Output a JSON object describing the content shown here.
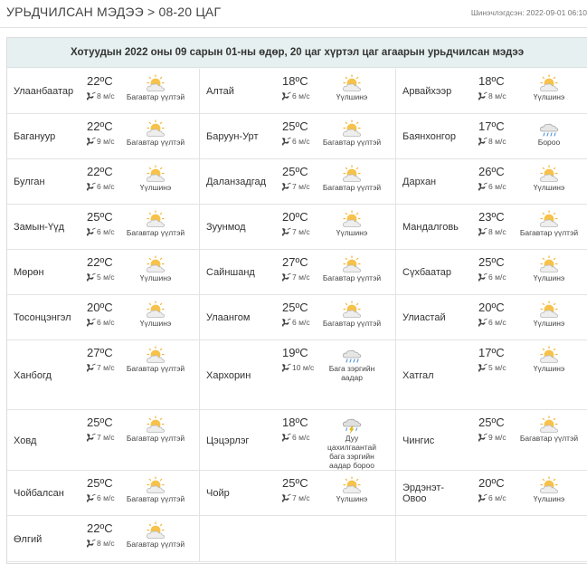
{
  "header": {
    "title": "УРЬДЧИЛСАН МЭДЭЭ > 08-20 ЦАГ",
    "updated": "Шинэчлэгдсэн: 2022-09-01 06:10"
  },
  "banner": {
    "text": "Хотуудын 2022 оны 09 сарын 01-ны өдөр, 20 цаг хүртэл цаг агаарын урьдчилсан мэдээ"
  },
  "temp_unit": "ºC",
  "wind_unit": "м/с",
  "icon_names": {
    "sun-cloud": "partly-cloudy-icon",
    "rain": "rain-icon",
    "storm": "thunderstorm-icon"
  },
  "columns": [
    [
      {
        "city": "Улаанбаатар",
        "temp": "22",
        "wind": "8",
        "condition": "Багавтар үүлтэй",
        "icon": "sun-cloud"
      },
      {
        "city": "Багануур",
        "temp": "22",
        "wind": "9",
        "condition": "Багавтар үүлтэй",
        "icon": "sun-cloud"
      },
      {
        "city": "Булган",
        "temp": "22",
        "wind": "6",
        "condition": "Үүлшинэ",
        "icon": "sun-cloud"
      },
      {
        "city": "Замын-Үүд",
        "temp": "25",
        "wind": "6",
        "condition": "Багавтар үүлтэй",
        "icon": "sun-cloud"
      },
      {
        "city": "Мөрөн",
        "temp": "22",
        "wind": "5",
        "condition": "Үүлшинэ",
        "icon": "sun-cloud"
      },
      {
        "city": "Тосонцэнгэл",
        "temp": "20",
        "wind": "6",
        "condition": "Үүлшинэ",
        "icon": "sun-cloud"
      },
      {
        "city": "Ханбогд",
        "temp": "27",
        "wind": "7",
        "condition": "Багавтар үүлтэй",
        "icon": "sun-cloud"
      },
      {
        "city": "Ховд",
        "temp": "25",
        "wind": "7",
        "condition": "Багавтар үүлтэй",
        "icon": "sun-cloud"
      },
      {
        "city": "Чойбалсан",
        "temp": "25",
        "wind": "6",
        "condition": "Багавтар үүлтэй",
        "icon": "sun-cloud"
      },
      {
        "city": "Өлгий",
        "temp": "22",
        "wind": "8",
        "condition": "Багавтар үүлтэй",
        "icon": "sun-cloud"
      }
    ],
    [
      {
        "city": "Алтай",
        "temp": "18",
        "wind": "6",
        "condition": "Үүлшинэ",
        "icon": "sun-cloud"
      },
      {
        "city": "Баруун-Урт",
        "temp": "25",
        "wind": "6",
        "condition": "Багавтар үүлтэй",
        "icon": "sun-cloud"
      },
      {
        "city": "Даланзадгад",
        "temp": "25",
        "wind": "7",
        "condition": "Багавтар үүлтэй",
        "icon": "sun-cloud"
      },
      {
        "city": "Зуунмод",
        "temp": "20",
        "wind": "7",
        "condition": "Үүлшинэ",
        "icon": "sun-cloud"
      },
      {
        "city": "Сайншанд",
        "temp": "27",
        "wind": "7",
        "condition": "Багавтар үүлтэй",
        "icon": "sun-cloud"
      },
      {
        "city": "Улаангом",
        "temp": "25",
        "wind": "6",
        "condition": "Багавтар үүлтэй",
        "icon": "sun-cloud"
      },
      {
        "city": "Хархорин",
        "temp": "19",
        "wind": "10",
        "condition": "Бага зэргийн аадар",
        "icon": "rain"
      },
      {
        "city": "Цэцэрлэг",
        "temp": "18",
        "wind": "6",
        "condition": "Дуу цахилгаантай бага зэргийн аадар бороо",
        "icon": "storm"
      },
      {
        "city": "Чойр",
        "temp": "25",
        "wind": "7",
        "condition": "Үүлшинэ",
        "icon": "sun-cloud"
      }
    ],
    [
      {
        "city": "Арвайхээр",
        "temp": "18",
        "wind": "8",
        "condition": "Үүлшинэ",
        "icon": "sun-cloud"
      },
      {
        "city": "Баянхонгор",
        "temp": "17",
        "wind": "8",
        "condition": "Бороо",
        "icon": "rain"
      },
      {
        "city": "Дархан",
        "temp": "26",
        "wind": "6",
        "condition": "Үүлшинэ",
        "icon": "sun-cloud"
      },
      {
        "city": "Мандалговь",
        "temp": "23",
        "wind": "8",
        "condition": "Багавтар үүлтэй",
        "icon": "sun-cloud"
      },
      {
        "city": "Сүхбаатар",
        "temp": "25",
        "wind": "6",
        "condition": "Үүлшинэ",
        "icon": "sun-cloud"
      },
      {
        "city": "Улиастай",
        "temp": "20",
        "wind": "6",
        "condition": "Үүлшинэ",
        "icon": "sun-cloud"
      },
      {
        "city": "Хатгал",
        "temp": "17",
        "wind": "5",
        "condition": "Үүлшинэ",
        "icon": "sun-cloud"
      },
      {
        "city": "Чингис",
        "temp": "25",
        "wind": "9",
        "condition": "Багавтар үүлтэй",
        "icon": "sun-cloud"
      },
      {
        "city": "Эрдэнэт-Овоо",
        "temp": "20",
        "wind": "6",
        "condition": "Үүлшинэ",
        "icon": "sun-cloud"
      }
    ]
  ]
}
